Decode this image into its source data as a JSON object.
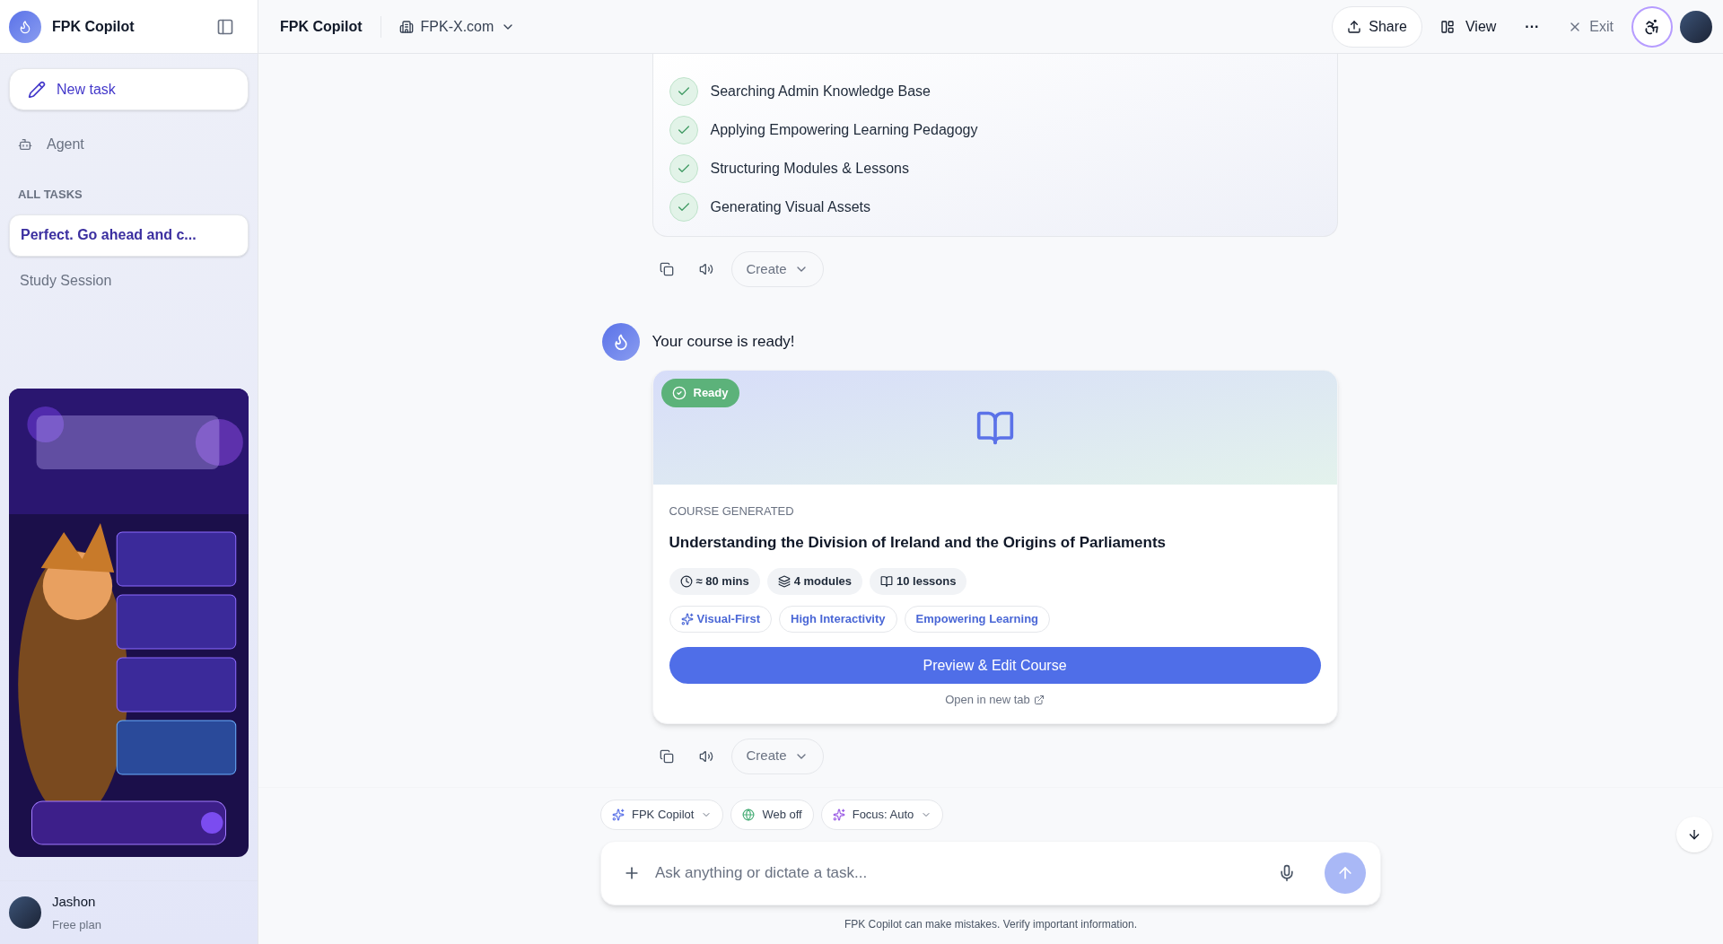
{
  "sidebar": {
    "app_name": "FPK Copilot",
    "new_task": "New task",
    "nav": [
      {
        "label": "Agent"
      }
    ],
    "section_title": "ALL TASKS",
    "tasks": [
      {
        "label": "Perfect. Go ahead and c...",
        "selected": true
      },
      {
        "label": "Study Session",
        "selected": false
      }
    ],
    "user": {
      "name": "Jashon",
      "plan": "Free plan"
    }
  },
  "header": {
    "title": "FPK Copilot",
    "workspace": "FPK-X.com",
    "actions": [
      {
        "kind": "share",
        "label": "Share"
      },
      {
        "kind": "view",
        "label": "View"
      },
      {
        "kind": "more",
        "label": "···"
      },
      {
        "kind": "exit",
        "label": "Exit"
      }
    ]
  },
  "build_steps": [
    {
      "label": "Searching Admin Knowledge Base",
      "done": true
    },
    {
      "label": "Applying Empowering Learning Pedagogy",
      "done": true
    },
    {
      "label": "Structuring Modules & Lessons",
      "done": true
    },
    {
      "label": "Generating Visual Assets",
      "done": true
    }
  ],
  "message_actions": [
    {
      "create": "Create"
    },
    {
      "create": "Create"
    }
  ],
  "message": {
    "text": "Your course is ready!"
  },
  "course": {
    "status": "Ready",
    "eyebrow": "COURSE GENERATED",
    "title": "Understanding the Division of Ireland and the Origins of Parliaments",
    "stats": [
      {
        "kind": "time",
        "label": "≈ 80 mins"
      },
      {
        "kind": "modules",
        "label": "4 modules"
      },
      {
        "kind": "lessons",
        "label": "10 lessons"
      }
    ],
    "tags": [
      {
        "label": "Visual-First",
        "icon": true
      },
      {
        "label": "High Interactivity",
        "icon": false
      },
      {
        "label": "Empowering Learning",
        "icon": false
      }
    ],
    "primary_button": "Preview & Edit Course",
    "link": "Open in new tab"
  },
  "composer": {
    "chips": [
      {
        "kind": "model",
        "label": "FPK Copilot"
      },
      {
        "kind": "web",
        "label": "Web off"
      },
      {
        "kind": "focus",
        "label": "Focus: Auto"
      }
    ],
    "placeholder": "Ask anything or dictate a task...",
    "disclaimer": "FPK Copilot can make mistakes. Verify important information."
  }
}
